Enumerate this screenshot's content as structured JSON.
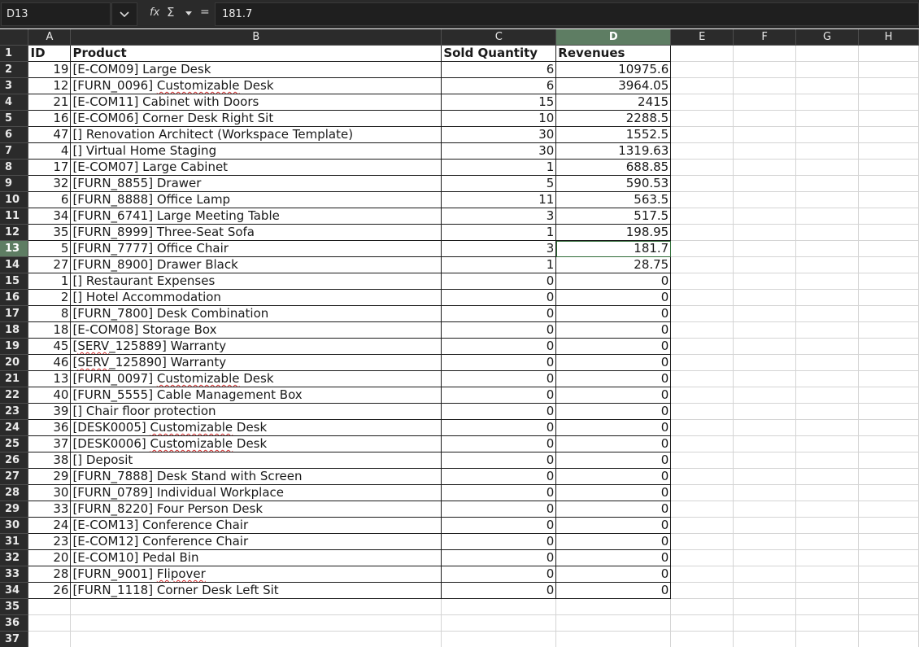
{
  "formula_bar": {
    "cell_ref": "D13",
    "formula_value": "181.7",
    "fx_symbol": "fx",
    "sigma_symbol": "Σ",
    "equals_symbol": "="
  },
  "sheet": {
    "columns": [
      "A",
      "B",
      "C",
      "D",
      "E",
      "F",
      "G",
      "H"
    ],
    "selected_column": "D",
    "selected_row": 13,
    "visible_row_count": 37,
    "header_row": {
      "id": "ID",
      "product": "Product",
      "qty": "Sold Quantity",
      "rev": "Revenues"
    },
    "rows": [
      {
        "id": "19",
        "product": "[E-COM09] Large Desk",
        "qty": "6",
        "rev": "10975.6"
      },
      {
        "id": "12",
        "product": "[FURN_0096] Customizable Desk",
        "qty": "6",
        "rev": "3964.05"
      },
      {
        "id": "21",
        "product": "[E-COM11] Cabinet with Doors",
        "qty": "15",
        "rev": "2415"
      },
      {
        "id": "16",
        "product": "[E-COM06] Corner Desk Right Sit",
        "qty": "10",
        "rev": "2288.5"
      },
      {
        "id": "47",
        "product": "[] Renovation Architect (Workspace Template)",
        "qty": "30",
        "rev": "1552.5"
      },
      {
        "id": "4",
        "product": "[] Virtual Home Staging",
        "qty": "30",
        "rev": "1319.63"
      },
      {
        "id": "17",
        "product": "[E-COM07] Large Cabinet",
        "qty": "1",
        "rev": "688.85"
      },
      {
        "id": "32",
        "product": "[FURN_8855] Drawer",
        "qty": "5",
        "rev": "590.53"
      },
      {
        "id": "6",
        "product": "[FURN_8888] Office Lamp",
        "qty": "11",
        "rev": "563.5"
      },
      {
        "id": "34",
        "product": "[FURN_6741] Large Meeting Table",
        "qty": "3",
        "rev": "517.5"
      },
      {
        "id": "35",
        "product": "[FURN_8999] Three-Seat Sofa",
        "qty": "1",
        "rev": "198.95"
      },
      {
        "id": "5",
        "product": "[FURN_7777] Office Chair",
        "qty": "3",
        "rev": "181.7"
      },
      {
        "id": "27",
        "product": "[FURN_8900] Drawer Black",
        "qty": "1",
        "rev": "28.75"
      },
      {
        "id": "1",
        "product": "[] Restaurant Expenses",
        "qty": "0",
        "rev": "0"
      },
      {
        "id": "2",
        "product": "[] Hotel Accommodation",
        "qty": "0",
        "rev": "0"
      },
      {
        "id": "8",
        "product": "[FURN_7800] Desk Combination",
        "qty": "0",
        "rev": "0"
      },
      {
        "id": "18",
        "product": "[E-COM08] Storage Box",
        "qty": "0",
        "rev": "0"
      },
      {
        "id": "45",
        "product": "[SERV_125889] Warranty",
        "qty": "0",
        "rev": "0"
      },
      {
        "id": "46",
        "product": "[SERV_125890] Warranty",
        "qty": "0",
        "rev": "0"
      },
      {
        "id": "13",
        "product": "[FURN_0097] Customizable Desk",
        "qty": "0",
        "rev": "0"
      },
      {
        "id": "40",
        "product": "[FURN_5555] Cable Management Box",
        "qty": "0",
        "rev": "0"
      },
      {
        "id": "39",
        "product": "[] Chair floor protection",
        "qty": "0",
        "rev": "0"
      },
      {
        "id": "36",
        "product": "[DESK0005] Customizable Desk",
        "qty": "0",
        "rev": "0"
      },
      {
        "id": "37",
        "product": "[DESK0006] Customizable Desk",
        "qty": "0",
        "rev": "0"
      },
      {
        "id": "38",
        "product": "[] Deposit",
        "qty": "0",
        "rev": "0"
      },
      {
        "id": "29",
        "product": "[FURN_7888] Desk Stand with Screen",
        "qty": "0",
        "rev": "0"
      },
      {
        "id": "30",
        "product": "[FURN_0789] Individual Workplace",
        "qty": "0",
        "rev": "0"
      },
      {
        "id": "33",
        "product": "[FURN_8220] Four Person Desk",
        "qty": "0",
        "rev": "0"
      },
      {
        "id": "24",
        "product": "[E-COM13] Conference Chair",
        "qty": "0",
        "rev": "0"
      },
      {
        "id": "23",
        "product": "[E-COM12] Conference Chair",
        "qty": "0",
        "rev": "0"
      },
      {
        "id": "20",
        "product": "[E-COM10] Pedal Bin",
        "qty": "0",
        "rev": "0"
      },
      {
        "id": "28",
        "product": "[FURN_9001] Flipover",
        "qty": "0",
        "rev": "0"
      },
      {
        "id": "26",
        "product": "[FURN_1118] Corner Desk Left Sit",
        "qty": "0",
        "rev": "0"
      }
    ]
  }
}
